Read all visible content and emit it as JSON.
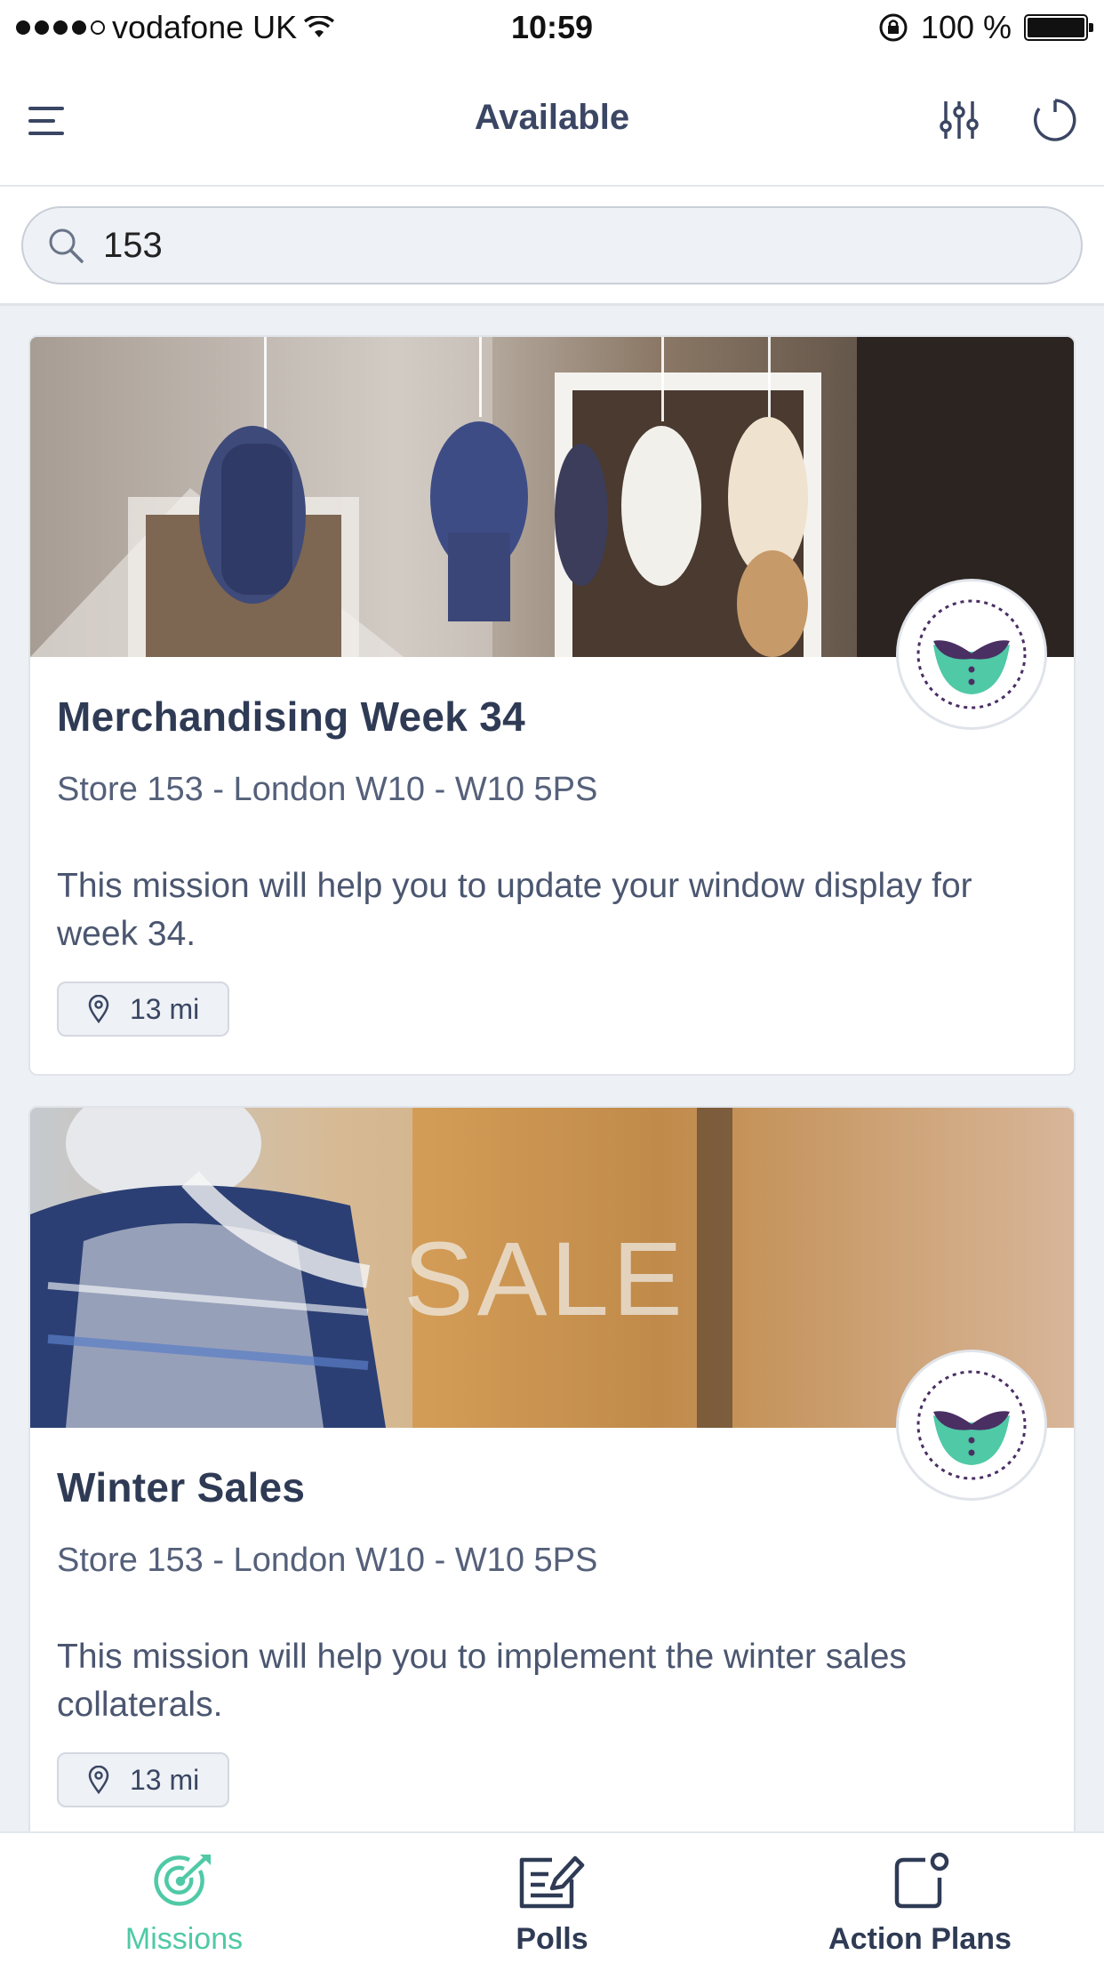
{
  "status_bar": {
    "carrier": "vodafone UK",
    "time": "10:59",
    "battery": "100 %"
  },
  "header": {
    "title": "Available",
    "menu_icon": "menu-icon",
    "filter_icon": "sliders-icon",
    "refresh_icon": "refresh-icon"
  },
  "search": {
    "value": "153",
    "icon": "search-icon"
  },
  "missions": [
    {
      "title": "Merchandising Week 34",
      "store": "Store 153 - London W10 - W10 5PS",
      "description": "This mission will help you to update your window display for week 34.",
      "distance": "13 mi",
      "image": "store-window-mannequins-photo"
    },
    {
      "title": "Winter Sales",
      "store": "Store 153 - London W10 - W10 5PS",
      "description": "This mission will help you to implement the winter sales collaterals.",
      "distance": "13 mi",
      "image": "sale-window-photo",
      "image_text": "SALE"
    }
  ],
  "bottom_nav": {
    "items": [
      {
        "label": "Missions",
        "icon": "target-icon",
        "active": true
      },
      {
        "label": "Polls",
        "icon": "poll-edit-icon",
        "active": false
      },
      {
        "label": "Action Plans",
        "icon": "action-plan-icon",
        "active": false
      }
    ]
  },
  "colors": {
    "accent": "#4fc9a6",
    "text_primary": "#2f3b55",
    "badge_purple": "#4a2f63",
    "badge_green": "#4fc9a6"
  }
}
